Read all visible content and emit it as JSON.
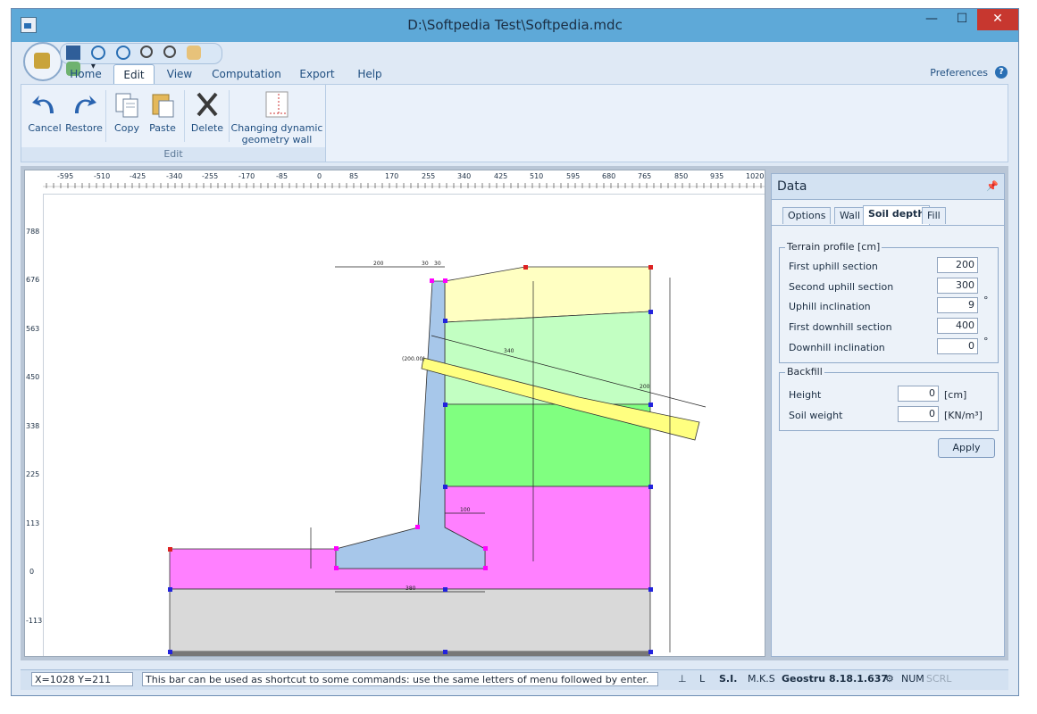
{
  "window": {
    "title": "D:\\Softpedia Test\\Softpedia.mdc"
  },
  "menu": {
    "tabs": [
      "Home",
      "Edit",
      "View",
      "Computation",
      "Export",
      "Help"
    ],
    "active_tab": "Edit",
    "preferences": "Preferences"
  },
  "ribbon": {
    "cancel": "Cancel",
    "restore": "Restore",
    "copy": "Copy",
    "paste": "Paste",
    "delete": "Delete",
    "changing_line1": "Changing dynamic",
    "changing_line2": "geometry wall",
    "group_label": "Edit"
  },
  "ruler": {
    "x_ticks": [
      "-595",
      "-510",
      "-425",
      "-340",
      "-255",
      "-170",
      "-85",
      "0",
      "85",
      "170",
      "255",
      "340",
      "425",
      "510",
      "595",
      "680",
      "765",
      "850",
      "935",
      "1020"
    ],
    "y_ticks": [
      "788",
      "676",
      "563",
      "450",
      "338",
      "225",
      "113",
      "0",
      "-113"
    ]
  },
  "drawing": {
    "dims": {
      "top_200": "200",
      "top_30a": "30",
      "top_30b": "30",
      "d100": "100",
      "d380": "380",
      "d340": "340",
      "d200": "200",
      "lbl_200_00": "(200.00)"
    },
    "colors": {
      "stem": "#a7c7ea",
      "soil_yellow": "#ffffc2",
      "soil_lightgreen": "#c2ffc2",
      "soil_green": "#80ff80",
      "soil_pink": "#ff80ff",
      "soil_gray": "#d9d9d9",
      "anchor": "#ffff80"
    }
  },
  "panel": {
    "title": "Data",
    "tabs": [
      "Options",
      "Wall",
      "Soil depth",
      "Fill"
    ],
    "active_tab": "Soil depth",
    "terrain": {
      "legend": "Terrain profile [cm]",
      "rows": [
        {
          "label": "First uphill section",
          "value": "200",
          "unit": ""
        },
        {
          "label": "Second uphill section",
          "value": "300",
          "unit": ""
        },
        {
          "label": "Uphill inclination",
          "value": "9",
          "unit": "°"
        },
        {
          "label": "First downhill section",
          "value": "400",
          "unit": ""
        },
        {
          "label": "Downhill inclination",
          "value": "0",
          "unit": "°"
        }
      ]
    },
    "backfill": {
      "legend": "Backfill",
      "rows": [
        {
          "label": "Height",
          "value": "0",
          "unit": "[cm]"
        },
        {
          "label": "Soil weight",
          "value": "0",
          "unit": "[KN/m³]"
        }
      ]
    },
    "apply": "Apply"
  },
  "status": {
    "coords": "X=1028  Y=211",
    "hint": "This bar can be used as shortcut to some commands: use the same letters of menu followed by enter.",
    "units1": "S.I.",
    "units2": "M.K.S",
    "version": "Geostru 8.18.1.637",
    "num": "NUM",
    "scrl": "SCRL"
  }
}
